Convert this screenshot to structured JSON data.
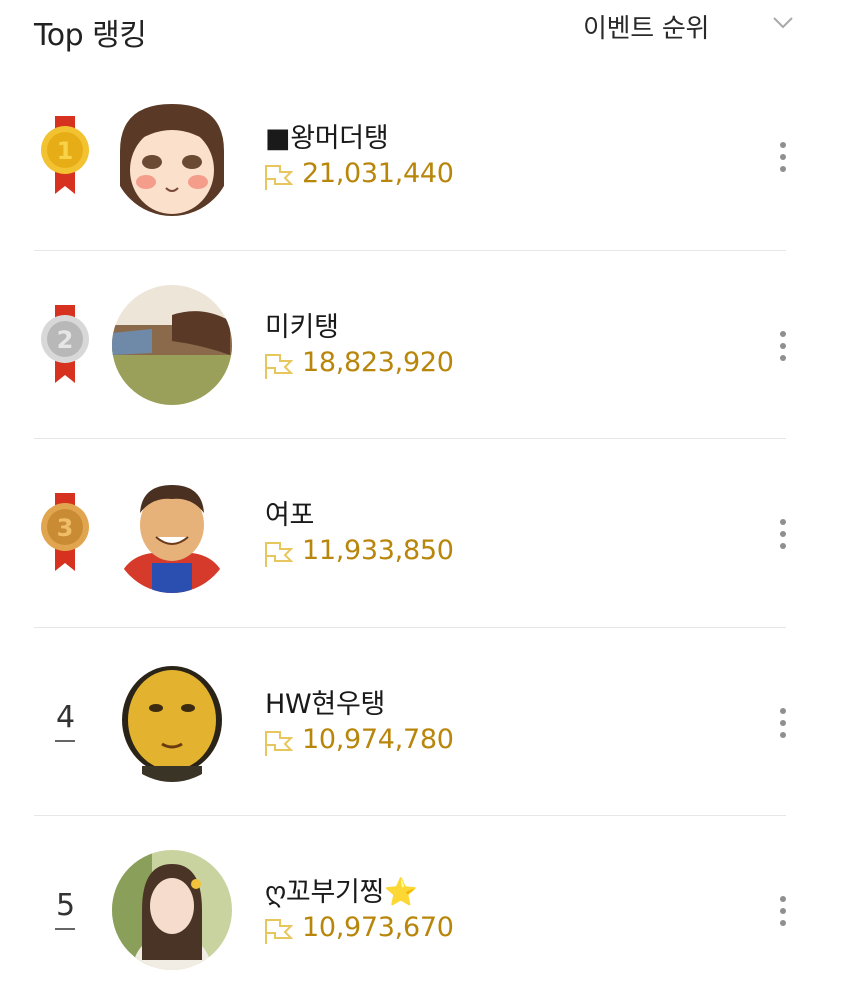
{
  "header": {
    "title": "Top 랭킹",
    "sort_label": "이벤트 순위"
  },
  "colors": {
    "score_gold": "#b8860b",
    "flag_gold": "#e8c65e",
    "medal_gold": "#e6ad17",
    "medal_silver": "#b8b8b8",
    "medal_bronze": "#c98c35",
    "ribbon_red": "#d6321f"
  },
  "rankings": [
    {
      "rank": "1",
      "medal": "gold",
      "name": "■왕머더탱",
      "score": "21,031,440",
      "icons": [
        "gold-medal-icon",
        "flag-icon",
        "more-vertical-icon"
      ]
    },
    {
      "rank": "2",
      "medal": "silver",
      "name": "미키탱",
      "score": "18,823,920",
      "icons": [
        "silver-medal-icon",
        "flag-icon",
        "more-vertical-icon"
      ]
    },
    {
      "rank": "3",
      "medal": "bronze",
      "name": "여포",
      "score": "11,933,850",
      "icons": [
        "bronze-medal-icon",
        "flag-icon",
        "more-vertical-icon"
      ]
    },
    {
      "rank": "4",
      "medal": "",
      "name": "HW현우탱",
      "score": "10,974,780",
      "icons": [
        "flag-icon",
        "more-vertical-icon"
      ]
    },
    {
      "rank": "5",
      "medal": "",
      "name": "ღ꼬부기찡⭐",
      "score": "10,973,670",
      "icons": [
        "flag-icon",
        "more-vertical-icon"
      ]
    }
  ]
}
